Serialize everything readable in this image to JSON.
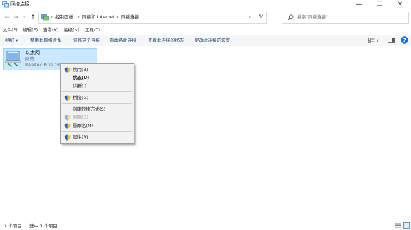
{
  "window": {
    "title": "网络连接",
    "minimize_glyph": "—",
    "maximize_glyph": "☐",
    "close_glyph": "✕"
  },
  "nav": {
    "back_glyph": "←",
    "forward_glyph": "→",
    "recent_glyph": "∨",
    "up_glyph": "↑",
    "refresh_glyph": "↻",
    "dropdown_glyph": "∨",
    "breadcrumb": [
      "控制面板",
      "网络和 Internet",
      "网络连接"
    ],
    "separator": "›"
  },
  "search": {
    "placeholder": "搜索\"网络连接\""
  },
  "menu": [
    "文件(F)",
    "编辑(E)",
    "查看(V)",
    "高级(N)",
    "工具(T)"
  ],
  "commands": {
    "organize": "组织 ▾",
    "items": [
      "禁用此网络设备",
      "诊断这个连接",
      "重命名此连接",
      "查看此连接的状态",
      "更改此连接的设置"
    ]
  },
  "adapter": {
    "name": "以太网",
    "status": "网络",
    "device": "Realtek PCIe Gb"
  },
  "context_menu": {
    "groups": [
      [
        {
          "label": "禁用(B)",
          "shield": true,
          "bold": false,
          "disabled": false
        },
        {
          "label": "状态(U)",
          "shield": false,
          "bold": true,
          "disabled": false
        },
        {
          "label": "诊断(I)",
          "shield": false,
          "bold": false,
          "disabled": false
        }
      ],
      [
        {
          "label": "桥接(G)",
          "shield": true,
          "bold": false,
          "disabled": false
        }
      ],
      [
        {
          "label": "创建快捷方式(S)",
          "shield": false,
          "bold": false,
          "disabled": false
        },
        {
          "label": "删除(D)",
          "shield": true,
          "bold": false,
          "disabled": true
        },
        {
          "label": "重命名(M)",
          "shield": true,
          "bold": false,
          "disabled": false
        }
      ],
      [
        {
          "label": "属性(R)",
          "shield": true,
          "bold": false,
          "disabled": false
        }
      ]
    ]
  },
  "status": {
    "count": "1 个项目",
    "selected": "选中 1 个项目"
  },
  "colors": {
    "selection_bg": "#cce8ff",
    "selection_border": "#99d1ff",
    "help_blue": "#1e6fd9",
    "command_text": "#1a3e6e"
  },
  "icons": [
    "network-connections-icon",
    "back-icon",
    "forward-icon",
    "up-icon",
    "refresh-icon",
    "search-icon",
    "view-options-icon",
    "preview-pane-icon",
    "help-icon",
    "ethernet-adapter-icon",
    "uac-shield-icon",
    "details-view-icon",
    "large-icons-view-icon"
  ]
}
